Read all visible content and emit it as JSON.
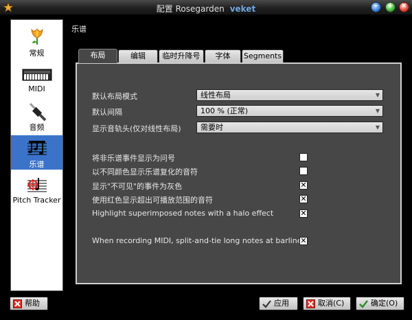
{
  "window": {
    "title": "配置 Rosegarden",
    "subtitle": "veket"
  },
  "sidebar": {
    "items": [
      {
        "label": "常规",
        "icon": "tulip-icon"
      },
      {
        "label": "MIDI",
        "icon": "keyboard-icon"
      },
      {
        "label": "音频",
        "icon": "audio-jack-icon"
      },
      {
        "label": "乐谱",
        "icon": "notation-icon",
        "active": true
      },
      {
        "label": "Pitch Tracker",
        "icon": "pitch-tracker-icon"
      }
    ]
  },
  "section_title": "乐谱",
  "tabs": [
    {
      "label": "布局",
      "active": true
    },
    {
      "label": "编辑"
    },
    {
      "label": "临时升降号"
    },
    {
      "label": "字体"
    },
    {
      "label": "Segments"
    }
  ],
  "layout": {
    "rows": [
      {
        "label": "默认布局模式",
        "value": "线性布局"
      },
      {
        "label": "默认间隔",
        "value": "100 % (正常)"
      },
      {
        "label": "显示音轨头(仅对线性布局)",
        "value": "需要时"
      }
    ],
    "checks": [
      {
        "label": "将非乐谱事件显示为问号",
        "checked": false
      },
      {
        "label": "以不同颜色显示乐谱复化的音符",
        "checked": false
      },
      {
        "label": "显示\"不可见\"的事件为灰色",
        "checked": true
      },
      {
        "label": "使用红色显示超出可播放范围的音符",
        "checked": true
      },
      {
        "label": "Highlight superimposed notes with a halo effect",
        "checked": true
      },
      {
        "label": "When recording MIDI, split-and-tie long notes at barlines",
        "checked": true
      }
    ],
    "check_mark": "✕"
  },
  "buttons": {
    "help": "帮助",
    "apply": "应用",
    "cancel": "取消(C)",
    "ok": "确定(O)"
  },
  "colors": {
    "accent": "#3b73c9",
    "panel": "#474747"
  }
}
